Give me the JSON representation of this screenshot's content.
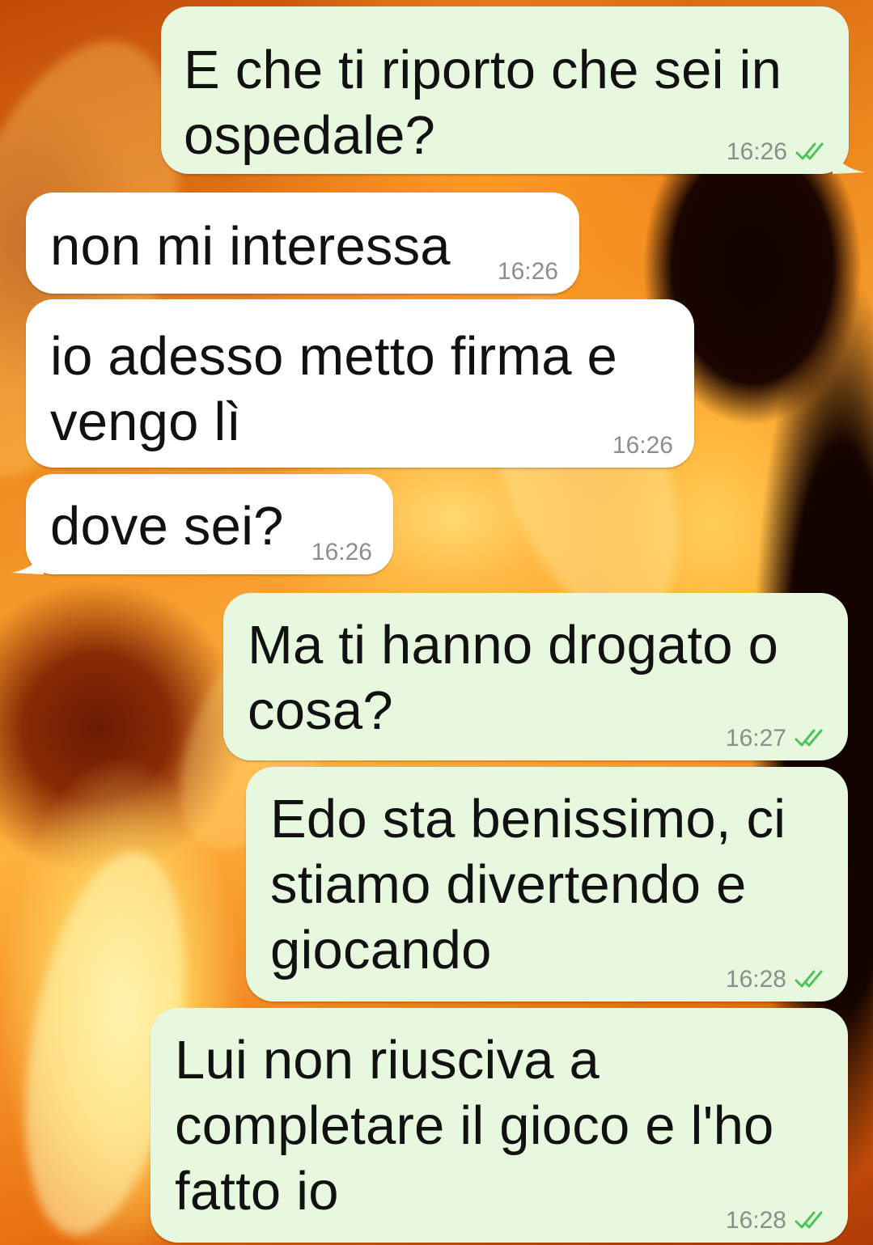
{
  "messages": [
    {
      "direction": "outgoing",
      "text": "E che ti riporto che sei in\nospedale?",
      "time": "16:26",
      "status_icon": "double-check-icon"
    },
    {
      "direction": "incoming",
      "text": "non mi interessa",
      "time": "16:26"
    },
    {
      "direction": "incoming",
      "text": "io adesso metto firma e\nvengo lì",
      "time": "16:26"
    },
    {
      "direction": "incoming",
      "text": "dove sei?",
      "time": "16:26"
    },
    {
      "direction": "outgoing",
      "text": "Ma ti hanno drogato o\ncosa?",
      "time": "16:27",
      "status_icon": "double-check-icon"
    },
    {
      "direction": "outgoing",
      "text": "Edo sta benissimo, ci\nstiamo divertendo e\ngiocando",
      "time": "16:28",
      "status_icon": "double-check-icon"
    },
    {
      "direction": "outgoing",
      "text": "Lui non riusciva a\ncompletare il gioco e l'ho\nfatto io",
      "time": "16:28",
      "status_icon": "double-check-icon"
    }
  ],
  "colors": {
    "outgoing_bubble": "#e7f8df",
    "incoming_bubble": "#ffffff",
    "timestamp": "#8a8f8c",
    "read_ticks": "#4fc35a",
    "wallpaper": "#e8750f"
  },
  "wallpaper": "flame-wallpaper"
}
